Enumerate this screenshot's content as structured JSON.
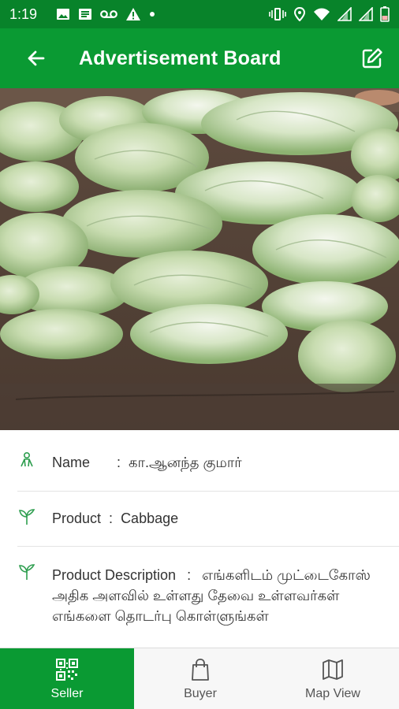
{
  "status_bar": {
    "time": "1:19",
    "left_icons": [
      "image-icon",
      "message-icon",
      "voicemail-icon",
      "warning-icon",
      "dot-icon"
    ],
    "right_icons": [
      "vibrate-icon",
      "location-icon",
      "wifi-icon",
      "signal-icon",
      "signal-icon",
      "battery-icon"
    ]
  },
  "app_bar": {
    "title": "Advertisement Board",
    "back_icon": "arrow-left-icon",
    "edit_icon": "edit-icon"
  },
  "hero": {
    "alt": "cabbage-photo"
  },
  "details": {
    "name": {
      "label": "Name",
      "sep": ":",
      "value": "கா.ஆனந்த குமார்",
      "icon": "person-icon"
    },
    "product": {
      "label": "Product",
      "sep": ":",
      "value": "Cabbage",
      "icon": "sprout-icon"
    },
    "description": {
      "label": "Product Description",
      "sep": ":",
      "value": "எங்களிடம் முட்டைகோஸ் அதிக அளவில் உள்ளது தேவை உள்ளவர்கள் எங்களை தொடர்பு கொள்ளுங்கள்",
      "icon": "sprout-icon"
    }
  },
  "bottom_nav": [
    {
      "label": "Seller",
      "icon": "qr-icon",
      "active": true
    },
    {
      "label": "Buyer",
      "icon": "shopping-bag-icon",
      "active": false
    },
    {
      "label": "Map View",
      "icon": "map-icon",
      "active": false
    }
  ],
  "colors": {
    "primary": "#0a9a33",
    "status": "#08832a",
    "accent_icon": "#2e9e4f"
  }
}
